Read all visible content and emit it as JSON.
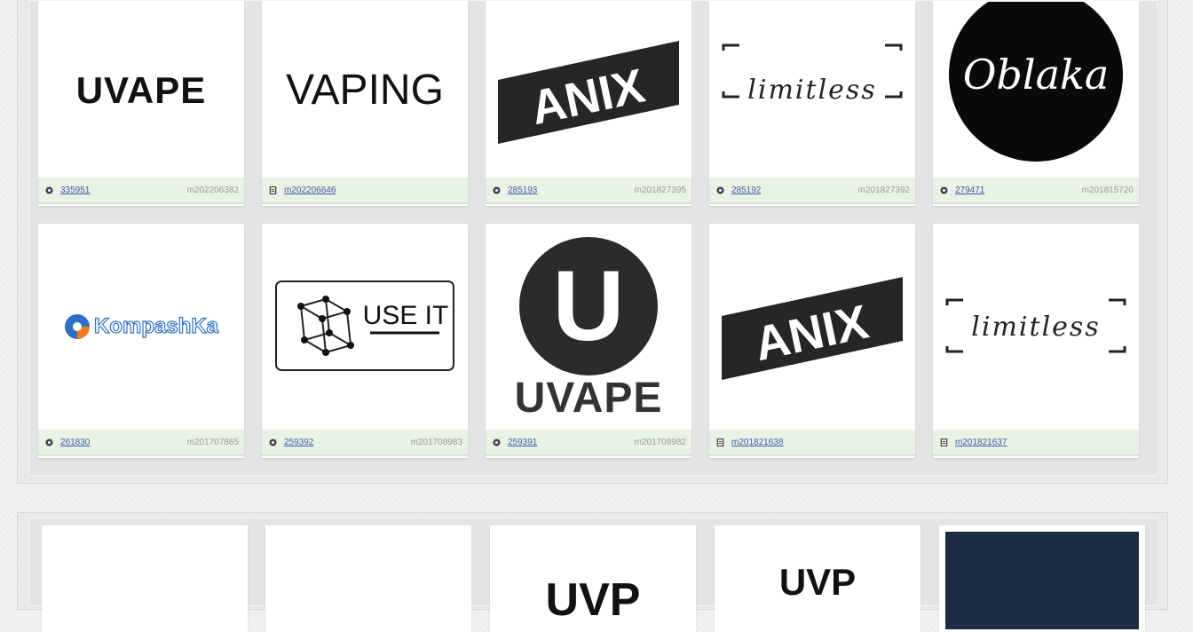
{
  "grid_top": {
    "cards": [
      {
        "logo_text": "UVAPE",
        "icon": "eye-icon",
        "number": "335951",
        "number_linked": true,
        "code": "m202206382"
      },
      {
        "logo_text": "VAPING",
        "icon": "document-icon",
        "number": "",
        "number_linked": false,
        "code": "m202206646"
      },
      {
        "logo_text": "ANIX",
        "icon": "eye-icon",
        "number": "285193",
        "number_linked": true,
        "code": "m201827395"
      },
      {
        "logo_text": "limitless",
        "icon": "eye-icon",
        "number": "285192",
        "number_linked": true,
        "code": "m201827392"
      },
      {
        "logo_text": "Oblaka",
        "icon": "eye-icon",
        "number": "279471",
        "number_linked": true,
        "code": "m201815720"
      },
      {
        "logo_text": "KompashKa",
        "icon": "eye-icon",
        "number": "261830",
        "number_linked": true,
        "code": "m201707865"
      },
      {
        "logo_text": "USE IT",
        "icon": "eye-icon",
        "number": "259392",
        "number_linked": true,
        "code": "m201708983"
      },
      {
        "logo_text": "UVAPE",
        "logo_letter": "U",
        "icon": "eye-icon",
        "number": "259391",
        "number_linked": true,
        "code": "m201708982"
      },
      {
        "logo_text": "ANIX",
        "icon": "document-icon",
        "number": "",
        "number_linked": false,
        "code": "m201821638"
      },
      {
        "logo_text": "limitless",
        "icon": "document-icon",
        "number": "",
        "number_linked": false,
        "code": "m201821637"
      }
    ]
  },
  "grid_bottom": {
    "cards": [
      {
        "logo_text": ""
      },
      {
        "logo_text": ""
      },
      {
        "logo_text": "UVP"
      },
      {
        "logo_text": "UVP"
      },
      {
        "logo_text": ""
      }
    ]
  },
  "colors": {
    "link": "#3d5aa8",
    "footer_bg": "#e8f2e5",
    "dark_tile": "#1c2a44"
  }
}
